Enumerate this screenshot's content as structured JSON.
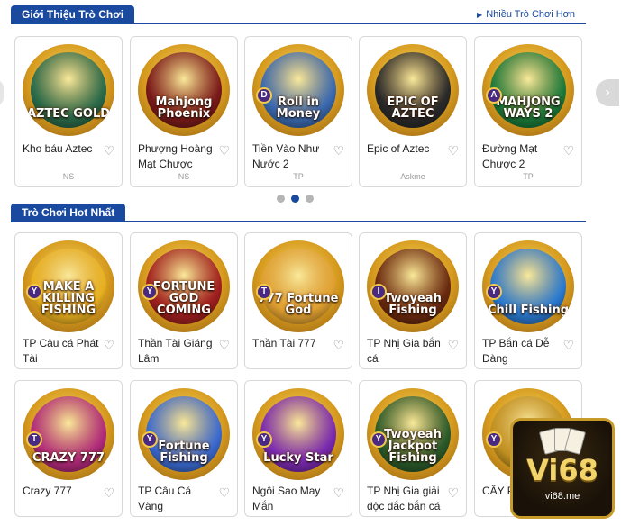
{
  "intro_section": {
    "title": "Giới Thiệu Trò Chơi",
    "more_link": "Nhiều Trò Chơi Hơn",
    "games": [
      {
        "name": "Kho báu Aztec",
        "logo": "AZTEC GOLD",
        "provider": "NS",
        "inner": "#2a6a4a"
      },
      {
        "name": "Phượng Hoàng Mạt Chược",
        "logo": "Mahjong Phoenix",
        "provider": "NS",
        "inner": "#7a1a1a"
      },
      {
        "name": "Tiền Vào Như Nước 2",
        "logo": "Roll in Money",
        "provider": "TP",
        "badge": "D",
        "inner": "#3a6ab0"
      },
      {
        "name": "Epic of Aztec",
        "logo": "EPIC OF AZTEC",
        "provider": "Askme",
        "inner": "#2a2a2a"
      },
      {
        "name": "Đường Mạt Chược 2",
        "logo": "MAHJONG WAYS 2",
        "provider": "TP",
        "badge": "A",
        "inner": "#1a7a3a"
      }
    ]
  },
  "hot_section": {
    "title": "Trò Chơi Hot Nhất",
    "games": [
      {
        "name": "TP Câu cá Phát Tài",
        "logo": "MAKE A KILLING FISHING",
        "badge": "Y",
        "inner": "#e8b020"
      },
      {
        "name": "Thần Tài Giáng Lâm",
        "logo": "FORTUNE GOD COMING",
        "badge": "Y",
        "inner": "#a02020"
      },
      {
        "name": "Thần Tài 777",
        "logo": "777 Fortune God",
        "badge": "T",
        "inner": "#e0a030"
      },
      {
        "name": "TP Nhị Gia bắn cá",
        "logo": "Twoyeah Fishing",
        "badge": "I",
        "inner": "#6a2a10"
      },
      {
        "name": "TP Bắn cá Dễ Dàng",
        "logo": "Chill Fishing",
        "badge": "Y",
        "inner": "#2a7ad0"
      },
      {
        "name": "Crazy 777",
        "logo": "CRAZY 777",
        "badge": "T",
        "inner": "#b02a7a"
      },
      {
        "name": "TP Câu Cá Vàng",
        "logo": "Fortune Fishing",
        "badge": "Y",
        "inner": "#3a6ad0"
      },
      {
        "name": "Ngôi Sao May Mắn",
        "logo": "Lucky Star",
        "badge": "Y",
        "inner": "#7a2ab0"
      },
      {
        "name": "TP Nhị Gia giải độc đắc bắn cá",
        "logo": "Twoyeah Jackpot Fishing",
        "badge": "Y",
        "inner": "#2a5a2a"
      },
      {
        "name": "CÂY PH",
        "logo": "RIC",
        "badge": "Y",
        "inner": "#c09020"
      }
    ]
  },
  "carousel": {
    "pages": 3,
    "active": 1
  },
  "watermark": {
    "brand": "Vi68",
    "url": "vi68.me"
  },
  "icons": {
    "heart": "heart-icon",
    "next": "chevron-right-icon"
  },
  "colors": {
    "accent": "#1a4aa0"
  }
}
